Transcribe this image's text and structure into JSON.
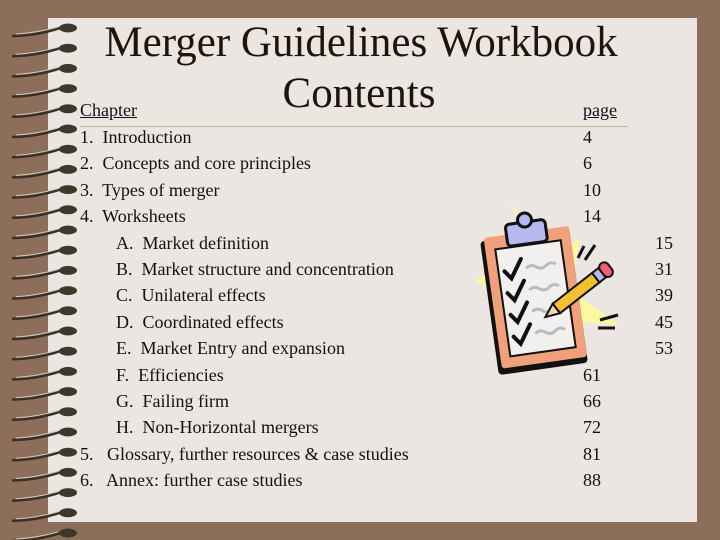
{
  "title": {
    "line1": "Merger Guidelines Workbook",
    "line2": "Contents"
  },
  "headers": {
    "chapter": "Chapter ",
    "page": "page"
  },
  "toc": [
    {
      "label": "1.  Introduction",
      "page": "4",
      "level": 1
    },
    {
      "label": "2.  Concepts and core principles",
      "page": "6",
      "level": 1
    },
    {
      "label": "3.  Types of merger",
      "page": "10",
      "level": 1
    },
    {
      "label": "4.  Worksheets",
      "page": "14",
      "level": 1
    },
    {
      "label": "A.  Market definition",
      "page": "15",
      "level": 2
    },
    {
      "label": "B.  Market structure and concentration",
      "page": "31",
      "level": 2
    },
    {
      "label": "C.  Unilateral effects",
      "page": "39",
      "level": 2
    },
    {
      "label": "D.  Coordinated effects",
      "page": "45",
      "level": 2
    },
    {
      "label": "E.  Market Entry and expansion",
      "page": "53",
      "level": 2
    },
    {
      "label": "F.  Efficiencies",
      "page": "61",
      "level": 2
    },
    {
      "label": "G.  Failing firm",
      "page": "66",
      "level": 2
    },
    {
      "label": "H.  Non-Horizontal mergers",
      "page": "72",
      "level": 2
    },
    {
      "label": "5.   Glossary, further resources & case studies",
      "page": "81",
      "level": 1
    },
    {
      "label": "6.   Annex: further case studies",
      "page": "88",
      "level": 1
    }
  ],
  "icons": {
    "illustration": "clipboard-checklist-icon",
    "binding": "spiral-binding-icon"
  },
  "colors": {
    "background": "#8c6e5a",
    "paper": "#ebe6e1",
    "text": "#111111",
    "rule": "#c2b49a"
  }
}
